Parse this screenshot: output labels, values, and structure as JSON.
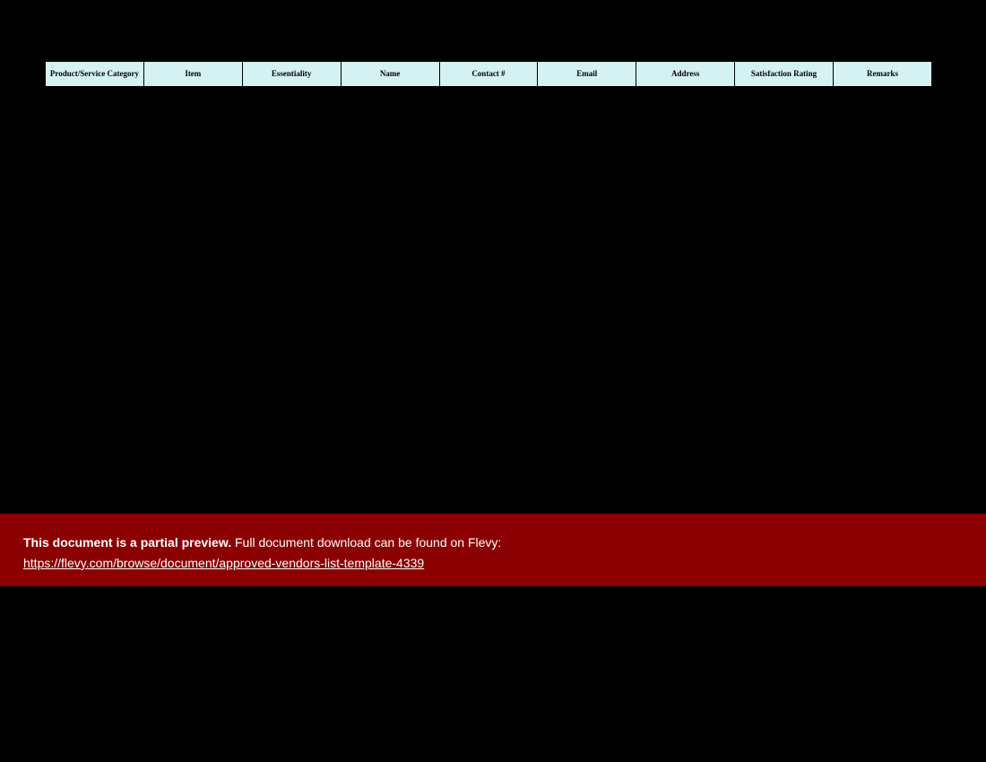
{
  "table": {
    "headers": [
      "Product/Service Category",
      "Item",
      "Essentiality",
      "Name",
      "Contact #",
      "Email",
      "Address",
      "Satisfaction Rating",
      "Remarks"
    ]
  },
  "banner": {
    "bold_text": "This document is a partial preview.",
    "followup_text": "  Full document download can be found on Flevy:",
    "link_text": "https://flevy.com/browse/document/approved-vendors-list-template-4339",
    "link_href": "https://flevy.com/browse/document/approved-vendors-list-template-4339"
  }
}
